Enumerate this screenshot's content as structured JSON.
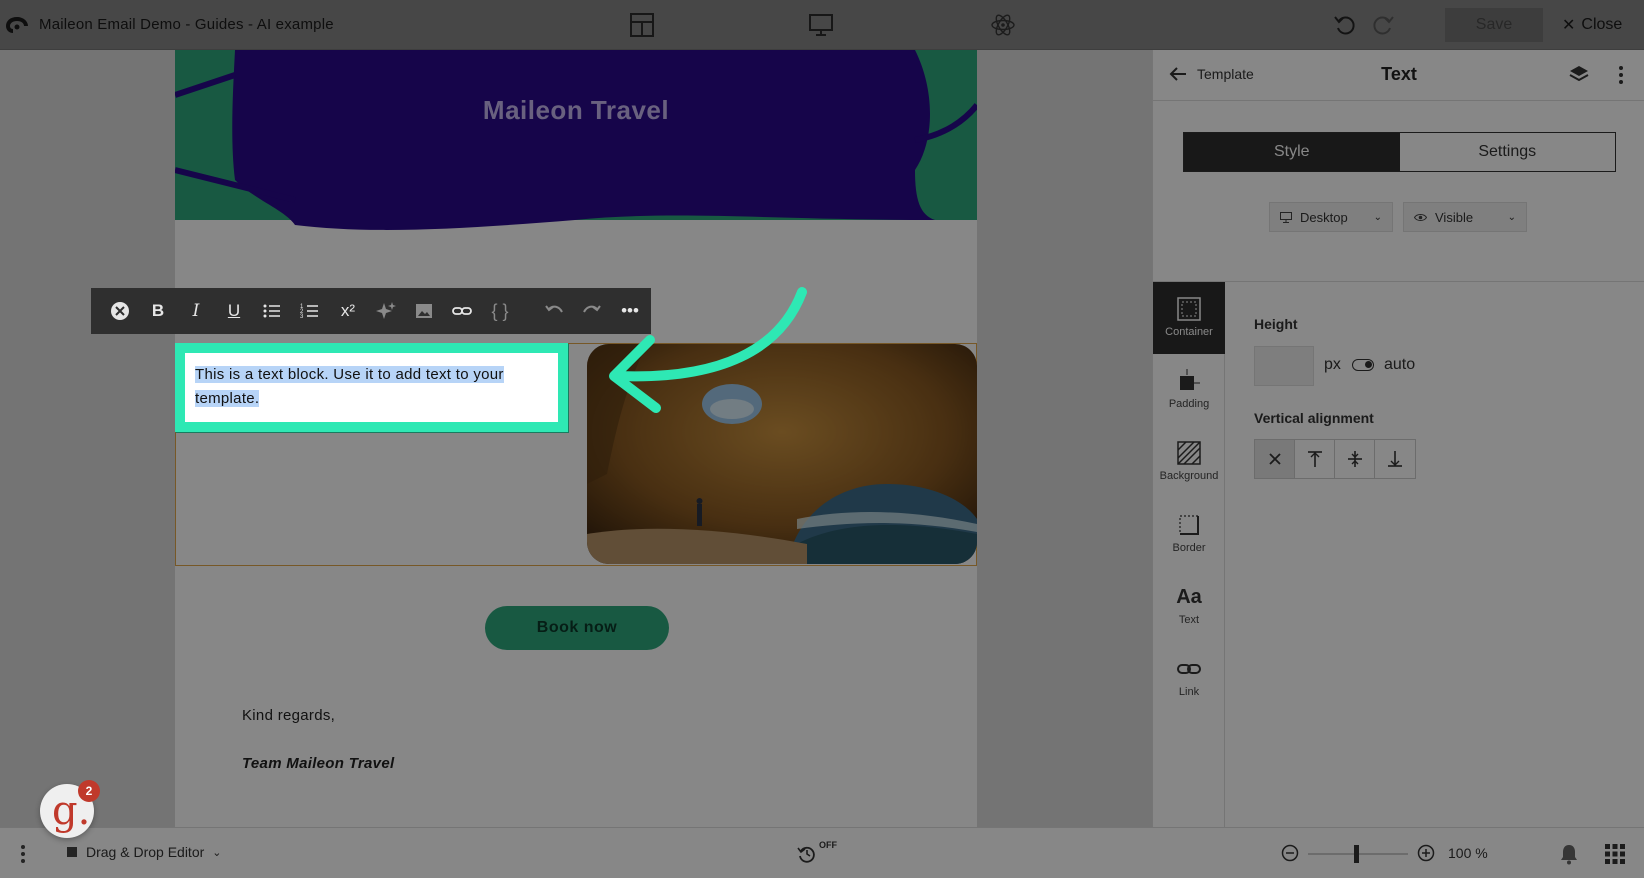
{
  "app": {
    "title": "Maileon Email Demo - Guides - AI example",
    "save_label": "Save",
    "close_label": "Close"
  },
  "email": {
    "header_title": "Maileon Travel",
    "text_block": "This is a text block. Use it to add text to your template.",
    "button_label": "Book now",
    "regards": "Kind regards,",
    "signature": "Team Maileon Travel"
  },
  "panel": {
    "back_label": "Template",
    "title": "Text",
    "tabs": [
      "Style",
      "Settings"
    ],
    "active_tab": "Style",
    "device_dropdown": "Desktop",
    "visibility_dropdown": "Visible",
    "side_tabs": [
      "Container",
      "Padding",
      "Background",
      "Border",
      "Text",
      "Link"
    ],
    "active_side_tab": "Container",
    "height_label": "Height",
    "height_value": "",
    "height_unit": "px",
    "height_auto_label": "auto",
    "valign_label": "Vertical alignment"
  },
  "bottom": {
    "editor_label": "Drag & Drop Editor",
    "autosave_state": "OFF",
    "zoom": "100 %"
  },
  "badge": {
    "letter": "g.",
    "count": "2"
  },
  "colors": {
    "accent": "#2ee8b4",
    "banner": "#2a0a8c",
    "leaf": "#2fa87e",
    "dark": "#2f2f2f"
  }
}
